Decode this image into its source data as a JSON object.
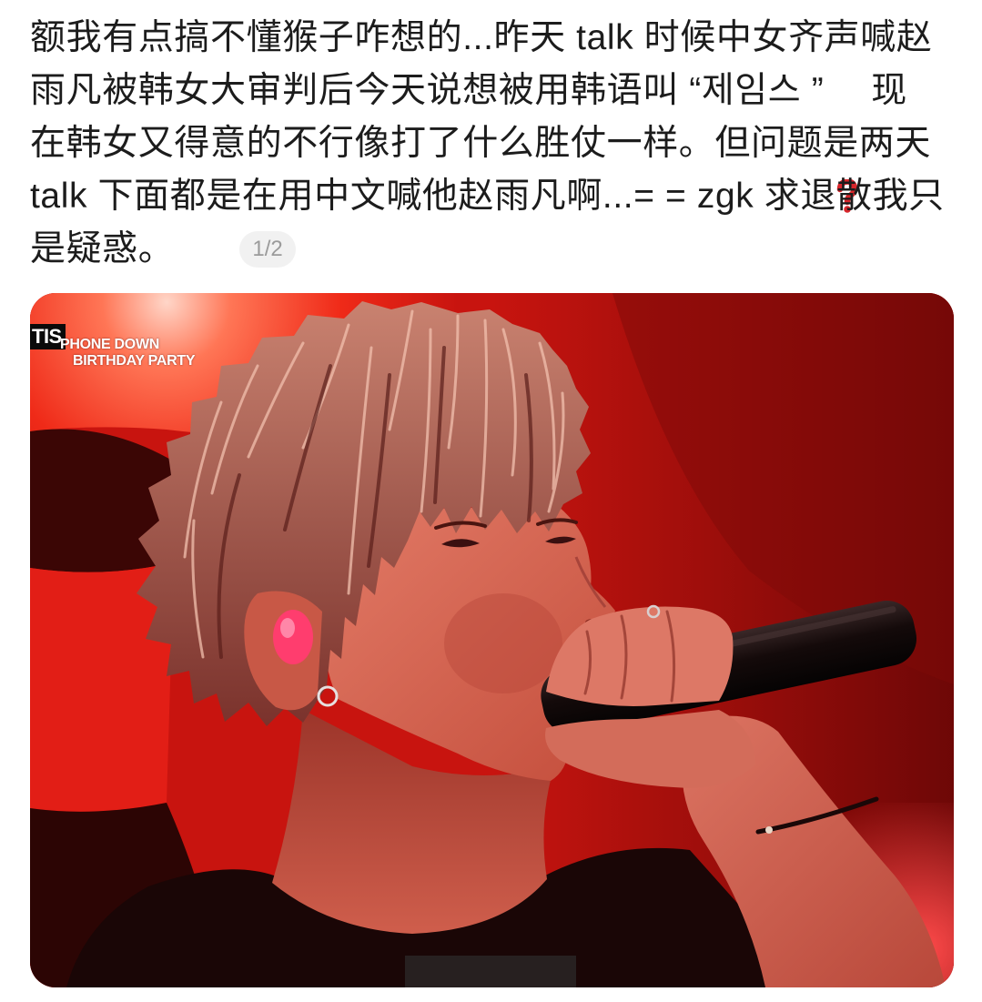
{
  "post": {
    "line_1": "额我有点搞不懂猴子咋想的...昨天 talk 时候中女齐声喊赵",
    "line_2": {
      "before_icon": "雨凡被韩女大审判后今天说想被用韩语叫 “제임스 ”",
      "after_icon": "现"
    },
    "line_3": "在韩女又得意的不行像打了什么胜仗一样。但问题是两天",
    "line_4": "talk 下面都是在用中文喊他赵雨凡啊...= = zgk 求退散我只",
    "line_5": "是疑惑。",
    "inline_icons": {
      "question": "red-question-mark-icon",
      "emoji": "pensive-face-emoji"
    }
  },
  "image_counter": "1/2",
  "photo": {
    "overlay_tag": "TIS",
    "overlay_title_line_1": "PHONE DOWN",
    "overlay_title_line_2": "BIRTHDAY PARTY"
  },
  "colors": {
    "text": "#1c1c1c",
    "question_icon": "#d7262b",
    "counter_background": "#f1f1f1",
    "counter_text": "#9b9b9b",
    "stage_light": "#c8140f"
  }
}
